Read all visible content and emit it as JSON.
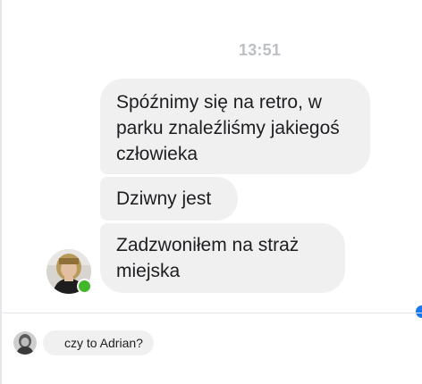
{
  "conversation": {
    "timestamp": "13:51",
    "messages": [
      {
        "text": "Spóźnimy się na retro, w parku znaleźliśmy jakiegoś człowieka"
      },
      {
        "text": "Dziwny jest"
      },
      {
        "text": "Zadzwoniłem na straż miejska"
      }
    ],
    "sender_avatar_icon": "avatar-icon",
    "sender_online": true
  },
  "preview": {
    "avatar_icon": "avatar-icon",
    "text": "czy to Adrian?"
  },
  "colors": {
    "bubble": "#f1f0f0",
    "text": "#1c1e21",
    "timestamp": "#bcc0c4",
    "online": "#42b72a",
    "accent": "#1877f2"
  }
}
